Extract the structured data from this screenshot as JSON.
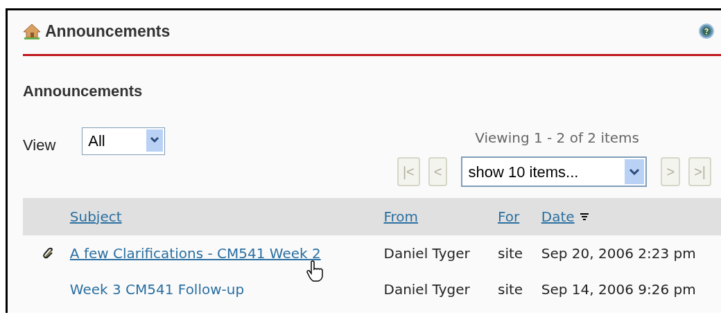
{
  "header": {
    "title": "Announcements"
  },
  "section_title": "Announcements",
  "view": {
    "label": "View",
    "value": "All"
  },
  "pager": {
    "summary": "Viewing 1 - 2 of 2 items",
    "page_size": "show 10 items...",
    "buttons": [
      {
        "label": "|<",
        "disabled": true
      },
      {
        "label": "<",
        "disabled": true
      }
    ],
    "buttons_after": [
      {
        "label": ">",
        "disabled": true
      },
      {
        "label": ">|",
        "disabled": true
      }
    ]
  },
  "table": {
    "columns": [
      {
        "label": "Subject",
        "sorted": false
      },
      {
        "label": "From",
        "sorted": false
      },
      {
        "label": "For",
        "sorted": false
      },
      {
        "label": "Date",
        "sorted": true
      }
    ],
    "rows": [
      {
        "attachment": true,
        "hovered": true,
        "subject": "A few Clarifications - CM541 Week 2",
        "from": "Daniel Tyger",
        "for": "site",
        "date": "Sep 20, 2006 2:23 pm"
      },
      {
        "attachment": false,
        "hovered": false,
        "subject": "Week 3 CM541 Follow-up",
        "from": "Daniel Tyger",
        "for": "site",
        "date": "Sep 14, 2006 9:26 pm"
      }
    ]
  }
}
